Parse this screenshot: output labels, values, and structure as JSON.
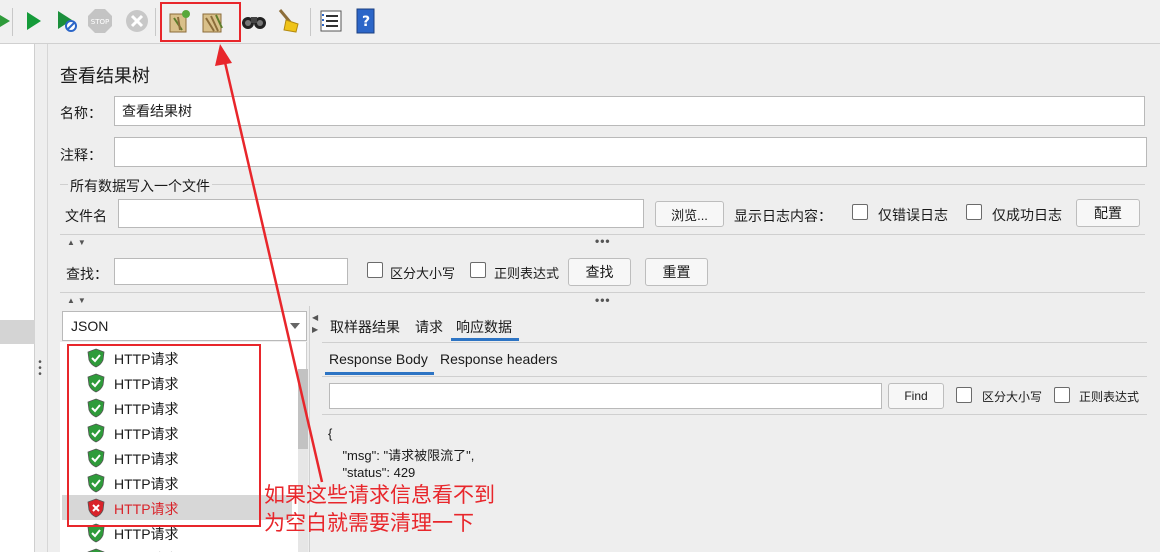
{
  "toolbar": {
    "icons": [
      "play-arrow-partial-icon",
      "play-icon",
      "play-no-pause-icon",
      "stop-icon",
      "shutdown-icon",
      "clear-icon",
      "clear-all-icon",
      "search-binoculars-icon",
      "broom-reset-icon",
      "function-helper-list-icon",
      "help-book-icon"
    ],
    "highlight_color": "#e8262b"
  },
  "title": "查看结果树",
  "name": {
    "label": "名称：",
    "value": "查看结果树"
  },
  "comment": {
    "label": "注释：",
    "value": ""
  },
  "file_section": {
    "heading": "所有数据写入一个文件",
    "filename_label": "文件名",
    "filename_value": "",
    "browse_label": "浏览...",
    "log_label": "显示日志内容：",
    "errors_only_label": "仅错误日志",
    "success_only_label": "仅成功日志",
    "config_label": "配置"
  },
  "search": {
    "label": "查找：",
    "value": "",
    "case_label": "区分大小写",
    "regex_label": "正则表达式",
    "find_label": "查找",
    "reset_label": "重置"
  },
  "results": {
    "renderer": "JSON",
    "items": [
      {
        "label": "HTTP请求",
        "status": "success"
      },
      {
        "label": "HTTP请求",
        "status": "success"
      },
      {
        "label": "HTTP请求",
        "status": "success"
      },
      {
        "label": "HTTP请求",
        "status": "success"
      },
      {
        "label": "HTTP请求",
        "status": "success"
      },
      {
        "label": "HTTP请求",
        "status": "success"
      },
      {
        "label": "HTTP请求",
        "status": "error"
      },
      {
        "label": "HTTP请求",
        "status": "success"
      },
      {
        "label": "HTTP请求",
        "status": "success"
      }
    ]
  },
  "detail": {
    "tabs": [
      "取样器结果",
      "请求",
      "响应数据"
    ],
    "active_tab": "响应数据",
    "subtabs": [
      "Response Body",
      "Response headers"
    ],
    "active_subtab": "Response Body",
    "find_label": "Find",
    "case_label": "区分大小写",
    "regex_label": "正则表达式",
    "body_lines": [
      "{",
      "    \"msg\": \"请求被限流了\",",
      "    \"status\": 429"
    ]
  },
  "annotation": {
    "line1": "如果这些请求信息看不到",
    "line2": "为空白就需要清理一下",
    "color": "#e8262b"
  },
  "colors": {
    "success": "#2e9b3a",
    "error": "#d8232a",
    "tab_underline": "#2d74c4"
  }
}
